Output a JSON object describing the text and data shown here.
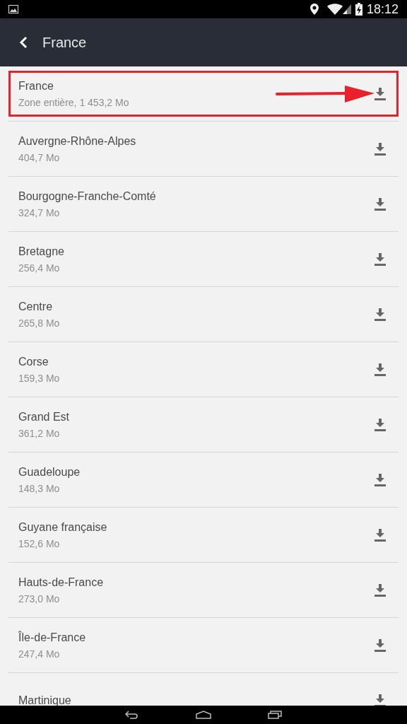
{
  "status_bar": {
    "time": "18:12"
  },
  "header": {
    "title": "France"
  },
  "regions": [
    {
      "name": "France",
      "size": "Zone entière, 1 453,2 Mo",
      "highlighted": true
    },
    {
      "name": "Auvergne-Rhône-Alpes",
      "size": "404,7 Mo",
      "highlighted": false
    },
    {
      "name": "Bourgogne-Franche-Comté",
      "size": "324,7 Mo",
      "highlighted": false
    },
    {
      "name": "Bretagne",
      "size": "256,4 Mo",
      "highlighted": false
    },
    {
      "name": "Centre",
      "size": "265,8 Mo",
      "highlighted": false
    },
    {
      "name": "Corse",
      "size": "159,3 Mo",
      "highlighted": false
    },
    {
      "name": "Grand Est",
      "size": "361,2 Mo",
      "highlighted": false
    },
    {
      "name": "Guadeloupe",
      "size": "148,3 Mo",
      "highlighted": false
    },
    {
      "name": "Guyane française",
      "size": "152,6 Mo",
      "highlighted": false
    },
    {
      "name": "Hauts-de-France",
      "size": "273,0 Mo",
      "highlighted": false
    },
    {
      "name": "Île-de-France",
      "size": "247,4 Mo",
      "highlighted": false
    },
    {
      "name": "Martinique",
      "highlighted": false
    }
  ]
}
